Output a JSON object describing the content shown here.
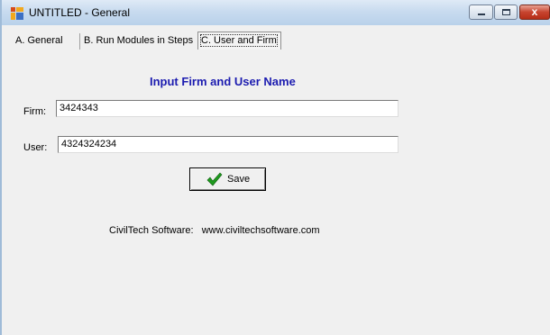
{
  "window": {
    "title": "UNTITLED - General",
    "controls": {
      "minimize": "minimize",
      "maximize": "maximize",
      "close": "x"
    }
  },
  "tabs": [
    {
      "label": "A. General",
      "selected": false
    },
    {
      "label": "B. Run Modules in Steps",
      "selected": false
    },
    {
      "label": "C. User and Firm",
      "selected": true
    }
  ],
  "form": {
    "heading": "Input Firm and User Name",
    "firm_label": "Firm:",
    "firm_value": "3424343",
    "user_label": "User:",
    "user_value": "4324324234",
    "save_label": "Save"
  },
  "footer": {
    "company": "CivilTech Software:",
    "website": "www.civiltechsoftware.com"
  },
  "colors": {
    "heading": "#1c1cb0",
    "titlebar": "#c8dbef",
    "panel": "#f0f0f0",
    "check": "#1e9b1e"
  },
  "icons": [
    "app-icon",
    "minimize-icon",
    "maximize-icon",
    "close-icon",
    "checkmark-icon"
  ]
}
